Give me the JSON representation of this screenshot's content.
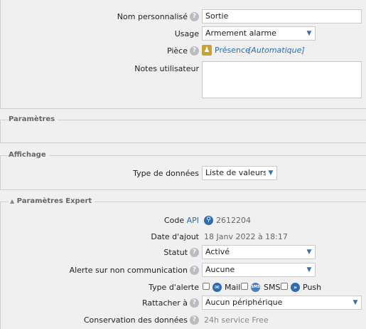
{
  "general": {
    "nom_label": "Nom personnalisé",
    "nom_value": "Sortie",
    "usage_label": "Usage",
    "usage_value": "Armement alarme",
    "piece_label": "Pièce",
    "piece_link": "Présence",
    "piece_auto": "[Automatique]",
    "notes_label": "Notes utilisateur",
    "notes_value": ""
  },
  "sections": {
    "parametres": "Paramètres",
    "affichage": "Affichage",
    "expert": "Paramètres Expert"
  },
  "affichage": {
    "type_label": "Type de données",
    "type_value": "Liste de valeurs"
  },
  "expert": {
    "code_label": "Code",
    "code_api": "API",
    "code_value": "2612204",
    "date_label": "Date d'ajout",
    "date_value": "18 Janv 2022 à 18:17",
    "statut_label": "Statut",
    "statut_value": "Activé",
    "alerte_nc_label": "Alerte sur non communication",
    "alerte_nc_value": "Aucune",
    "type_alerte_label": "Type d'alerte",
    "alert_mail": "Mail",
    "alert_sms": "SMS",
    "alert_push": "Push",
    "rattacher_label": "Rattacher à",
    "rattacher_value": "Aucun périphérique",
    "conservation_label": "Conservation des données",
    "conservation_value": "24h service Free"
  },
  "icons": {
    "help": "question-circle-icon",
    "dropdown": "chevron-down-icon",
    "room": "room-presence-icon",
    "key": "key-icon",
    "mail": "mail-icon",
    "sms": "sms-icon",
    "push": "push-icon",
    "collapse": "triangle-up-icon"
  },
  "colors": {
    "link": "#2d6bb5",
    "background": "#f0f0f0",
    "help_icon": "#b9bcc2"
  }
}
